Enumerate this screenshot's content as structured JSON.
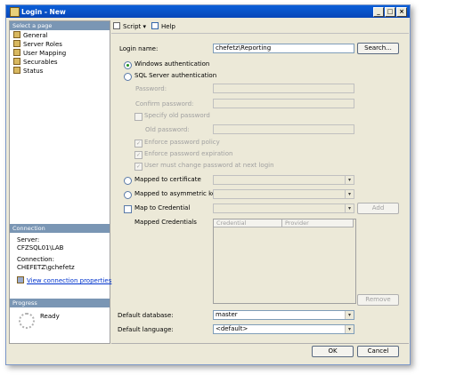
{
  "window": {
    "title": "Login - New",
    "min": "_",
    "max": "□",
    "close": "×"
  },
  "toolbar": {
    "script_label": "Script",
    "script_arrow": "▾",
    "help_label": "Help"
  },
  "select_page": {
    "header": "Select a page",
    "items": [
      "General",
      "Server Roles",
      "User Mapping",
      "Securables",
      "Status"
    ]
  },
  "connection": {
    "header": "Connection",
    "server_label": "Server:",
    "server_value": "CFZSQL01\\LAB",
    "connection_label": "Connection:",
    "connection_value": "CHEFETZ\\gchefetz",
    "view_link": "View connection properties"
  },
  "progress": {
    "header": "Progress",
    "status": "Ready"
  },
  "form": {
    "login_name_label": "Login name:",
    "login_name_value": "chefetz\\Reporting",
    "search_button": "Search...",
    "windows_auth": "Windows authentication",
    "sql_auth": "SQL Server authentication",
    "password_label": "Password:",
    "confirm_password_label": "Confirm password:",
    "specify_old_password": "Specify old password",
    "old_password_label": "Old password:",
    "enforce_policy": "Enforce password policy",
    "enforce_expiration": "Enforce password expiration",
    "must_change": "User must change password at next login",
    "mapped_certificate": "Mapped to certificate",
    "mapped_asym_key": "Mapped to asymmetric key",
    "map_credential": "Map to Credential",
    "add_button": "Add",
    "mapped_credentials_label": "Mapped Credentials",
    "grid_columns": [
      "Credential",
      "Provider"
    ],
    "remove_button": "Remove",
    "default_database_label": "Default database:",
    "default_database_value": "master",
    "default_language_label": "Default language:",
    "default_language_value": "<default>",
    "check_mark": "✓",
    "combo_arrow": "▾"
  },
  "footer": {
    "ok_button": "OK",
    "cancel_button": "Cancel"
  }
}
